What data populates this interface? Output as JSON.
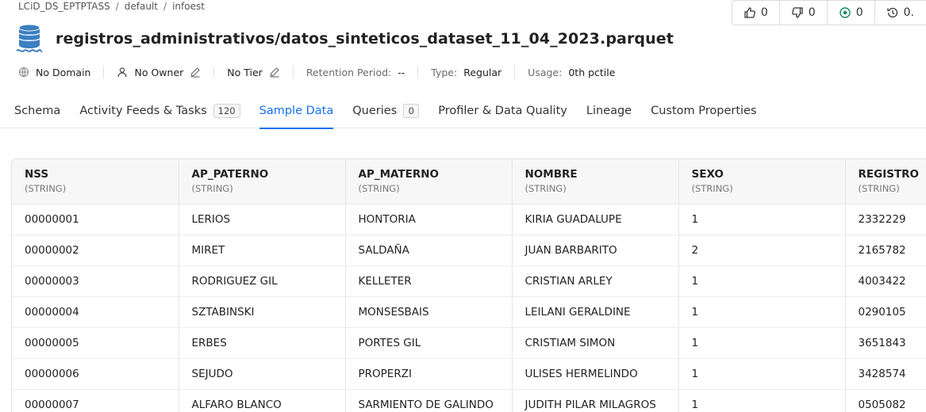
{
  "breadcrumb": [
    "LCiD_DS_EPTPTASS",
    "default",
    "infoest"
  ],
  "actions": [
    {
      "icon": "thumbs-up-icon",
      "count": "0"
    },
    {
      "icon": "thumbs-down-icon",
      "count": "0"
    },
    {
      "icon": "follow-icon",
      "count": "0"
    },
    {
      "icon": "version-history-icon",
      "count": "0."
    }
  ],
  "title": "registros_administrativos/datos_sinteticos_dataset_11_04_2023.parquet",
  "meta": {
    "domain": "No Domain",
    "owner": "No Owner",
    "tier": "No Tier",
    "retention_key": "Retention Period:",
    "retention_val": "--",
    "type_key": "Type:",
    "type_val": "Regular",
    "usage_key": "Usage:",
    "usage_val": "0th pctile"
  },
  "tabs": [
    {
      "label": "Schema"
    },
    {
      "label": "Activity Feeds & Tasks",
      "count": "120"
    },
    {
      "label": "Sample Data",
      "active": true
    },
    {
      "label": "Queries",
      "count": "0"
    },
    {
      "label": "Profiler & Data Quality"
    },
    {
      "label": "Lineage"
    },
    {
      "label": "Custom Properties"
    }
  ],
  "table": {
    "columns": [
      {
        "name": "NSS",
        "type": "(STRING)"
      },
      {
        "name": "AP_PATERNO",
        "type": "(STRING)"
      },
      {
        "name": "AP_MATERNO",
        "type": "(STRING)"
      },
      {
        "name": "NOMBRE",
        "type": "(STRING)"
      },
      {
        "name": "SEXO",
        "type": "(STRING)"
      },
      {
        "name": "REGISTRO",
        "type": "(STRING)"
      }
    ],
    "rows": [
      [
        "00000001",
        "LERIOS",
        "HONTORIA",
        "KIRIA GUADALUPE",
        "1",
        "2332229"
      ],
      [
        "00000002",
        "MIRET",
        "SALDAÑA",
        "JUAN BARBARITO",
        "2",
        "2165782"
      ],
      [
        "00000003",
        "RODRIGUEZ GIL",
        "KELLETER",
        "CRISTIAN ARLEY",
        "1",
        "4003422"
      ],
      [
        "00000004",
        "SZTABINSKI",
        "MONSESBAIS",
        "LEILANI GERALDINE",
        "1",
        "0290105"
      ],
      [
        "00000005",
        "ERBES",
        "PORTES GIL",
        "CRISTIAM SIMON",
        "1",
        "3651843"
      ],
      [
        "00000006",
        "SEJUDO",
        "PROPERZI",
        "ULISES HERMELINDO",
        "1",
        "3428574"
      ],
      [
        "00000007",
        "ALFARO BLANCO",
        "SARMIENTO DE GALINDO",
        "JUDITH PILAR MILAGROS",
        "1",
        "0505082"
      ]
    ]
  },
  "colors": {
    "accent": "#1570ef",
    "icon_blue": "#3d7fc1"
  }
}
